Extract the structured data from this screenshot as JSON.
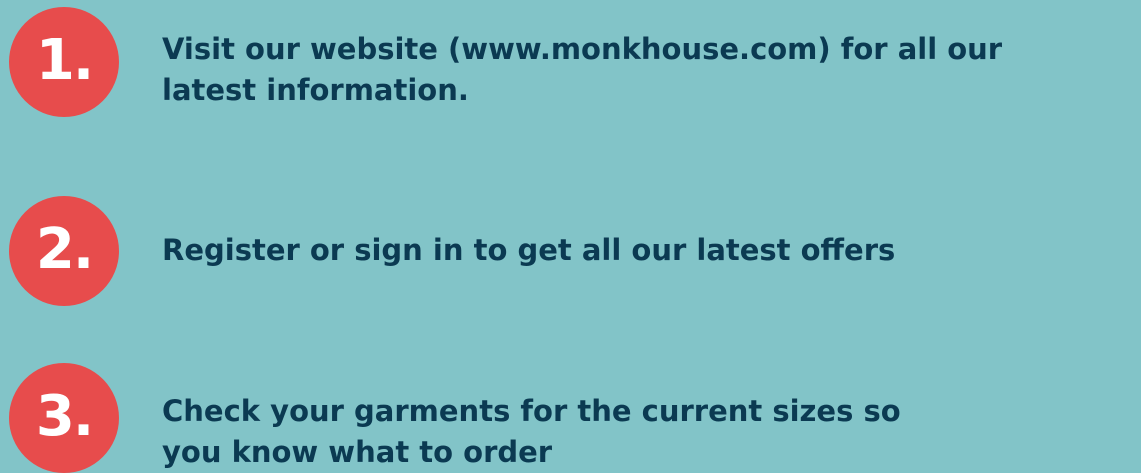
{
  "colors": {
    "background": "#82c4c8",
    "badge": "#e74c4c",
    "text": "#0b3a52"
  },
  "steps": [
    {
      "number": "1.",
      "line1": "Visit our website (www.monkhouse.com) for all our",
      "line2": "latest information."
    },
    {
      "number": "2.",
      "line1": "Register or sign in to get all our latest offers",
      "line2": ""
    },
    {
      "number": "3.",
      "line1": "Check your garments for the current sizes so",
      "line2": "you know what to order"
    }
  ]
}
